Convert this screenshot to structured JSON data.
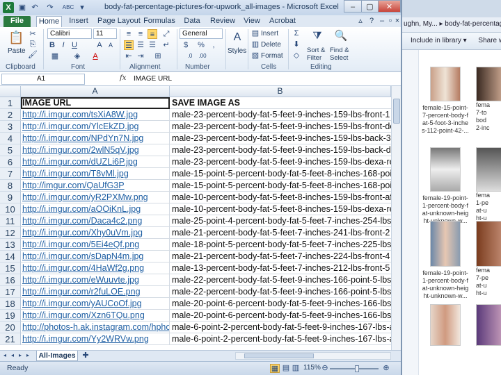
{
  "excel": {
    "window_title": "body-fat-percentage-pictures-for-upwork_all-images - Microsoft Excel",
    "file_tab": "File",
    "tabs": [
      "Home",
      "Insert",
      "Page Layout",
      "Formulas",
      "Data",
      "Review",
      "View",
      "Acrobat"
    ],
    "ribbon": {
      "paste": "Paste",
      "font_name": "Calibri",
      "font_size": "11",
      "number_format": "General",
      "styles": "Styles",
      "insert": "Insert",
      "delete": "Delete",
      "format": "Format",
      "sort_filter": "Sort & Filter",
      "find_select": "Find & Select",
      "groups": [
        "Clipboard",
        "Font",
        "Alignment",
        "Number",
        "Cells",
        "Editing"
      ]
    },
    "name_box": "A1",
    "fx": "fx",
    "formula": "IMAGE URL",
    "columns": [
      "A",
      "B"
    ],
    "rows": [
      [
        "IMAGE URL",
        "SAVE IMAGE AS"
      ],
      [
        "http://i.imgur.com/tsXiA8W.jpg",
        "male-23-percent-body-fat-5-feet-9-inches-159-lbs-front-1"
      ],
      [
        "http://i.imgur.com/YlcEkZD.jpg",
        "male-23-percent-body-fat-5-feet-9-inches-159-lbs-front-doub"
      ],
      [
        "http://i.imgur.com/NPdYn7N.jpg",
        "male-23-percent-body-fat-5-feet-9-inches-159-lbs-back-3"
      ],
      [
        "http://i.imgur.com/2wlN5qV.jpg",
        "male-23-percent-body-fat-5-feet-9-inches-159-lbs-back-doub"
      ],
      [
        "http://i.imgur.com/dUZLi6P.jpg",
        "male-23-percent-body-fat-5-feet-9-inches-159-lbs-dexa-result"
      ],
      [
        "http://i.imgur.com/T8vMl.jpg",
        "male-15-point-5-percent-body-fat-5-feet-8-inches-168-point-"
      ],
      [
        "http://imgur.com/QaUfG3P",
        "male-15-point-5-percent-body-fat-5-feet-8-inches-168-point-"
      ],
      [
        "http://i.imgur.com/yR2PXMw.png",
        "male-10-percent-body-fat-5-feet-8-inches-159-lbs-front-after"
      ],
      [
        "http://i.imgur.com/aOOiKnL.jpg",
        "male-10-percent-body-fat-5-feet-8-inches-159-lbs-dexa-result"
      ],
      [
        "http://i.imgur.com/Daca4c2.png",
        "male-25-point-4-percent-body-fat-5-feet-7-inches-254-lbs-fro"
      ],
      [
        "http://i.imgur.com/Xhy0uVm.jpg",
        "male-21-percent-body-fat-5-feet-7-inches-241-lbs-front-2"
      ],
      [
        "http://i.imgur.com/5Ei4eQf.png",
        "male-18-point-5-percent-body-fat-5-feet-7-inches-225-lbs-fro"
      ],
      [
        "http://i.imgur.com/sDapN4m.jpg",
        "male-21-percent-body-fat-5-feet-7-inches-224-lbs-front-4"
      ],
      [
        "http://i.imgur.com/4HaWf2g.png",
        "male-13-percent-body-fat-5-feet-7-inches-212-lbs-front-5"
      ],
      [
        "http://i.imgur.com/eWuuvte.jpg",
        "male-22-percent-body-fat-5-feet-9-inches-166-point-5-lbs-fro"
      ],
      [
        "http://i.imgur.com/r2fuLOE.png",
        "male-22-percent-body-fat-5-feet-9-inches-166-point-5-lbs-de"
      ],
      [
        "http://i.imgur.com/yAUCoOf.jpg",
        "male-20-point-6-percent-body-fat-5-feet-9-inches-166-lbs-fro"
      ],
      [
        "http://i.imgur.com/Xzn6TQu.png",
        "male-20-point-6-percent-body-fat-5-feet-9-inches-166-lbs-de"
      ],
      [
        "http://photos-h.ak.instagram.com/hphot",
        "male-6-point-2-percent-body-fat-5-feet-9-inches-167-lbs-albe"
      ],
      [
        "http://i.imgur.com/Yy2WRVw.png",
        "male-6-point-2-percent-body-fat-5-feet-9-inches-167-lbs-albe"
      ]
    ],
    "sheet_tab": "All-Images",
    "status": "Ready",
    "zoom": "115%",
    "zoom_fraction": 0.55
  },
  "explorer": {
    "address": "ughn, My... ▸ body-fat-percentage",
    "include": "Include in library ▾",
    "share": "Share with ▾",
    "items": [
      "female-15-point-\n7-percent-body-f\nat-5-foot-3-inche\ns-112-point-42-...",
      "fema\n7-to\nbod\n2-inc",
      "female-19-point-\n1-percent-body-f\nat-unknown-heig\nht-unknown-w...",
      "fema\n1-pe\nat-u\nht-u",
      "female-19-point-\n1-percent-body-f\nat-unknown-heig\nht-unknown-w...",
      "fema\n7-pe\nat-u\nht-u"
    ]
  },
  "colors": {
    "link": "#1f5fa3",
    "file_tab": "#2b7a3f",
    "selected": "#ffd86b"
  }
}
